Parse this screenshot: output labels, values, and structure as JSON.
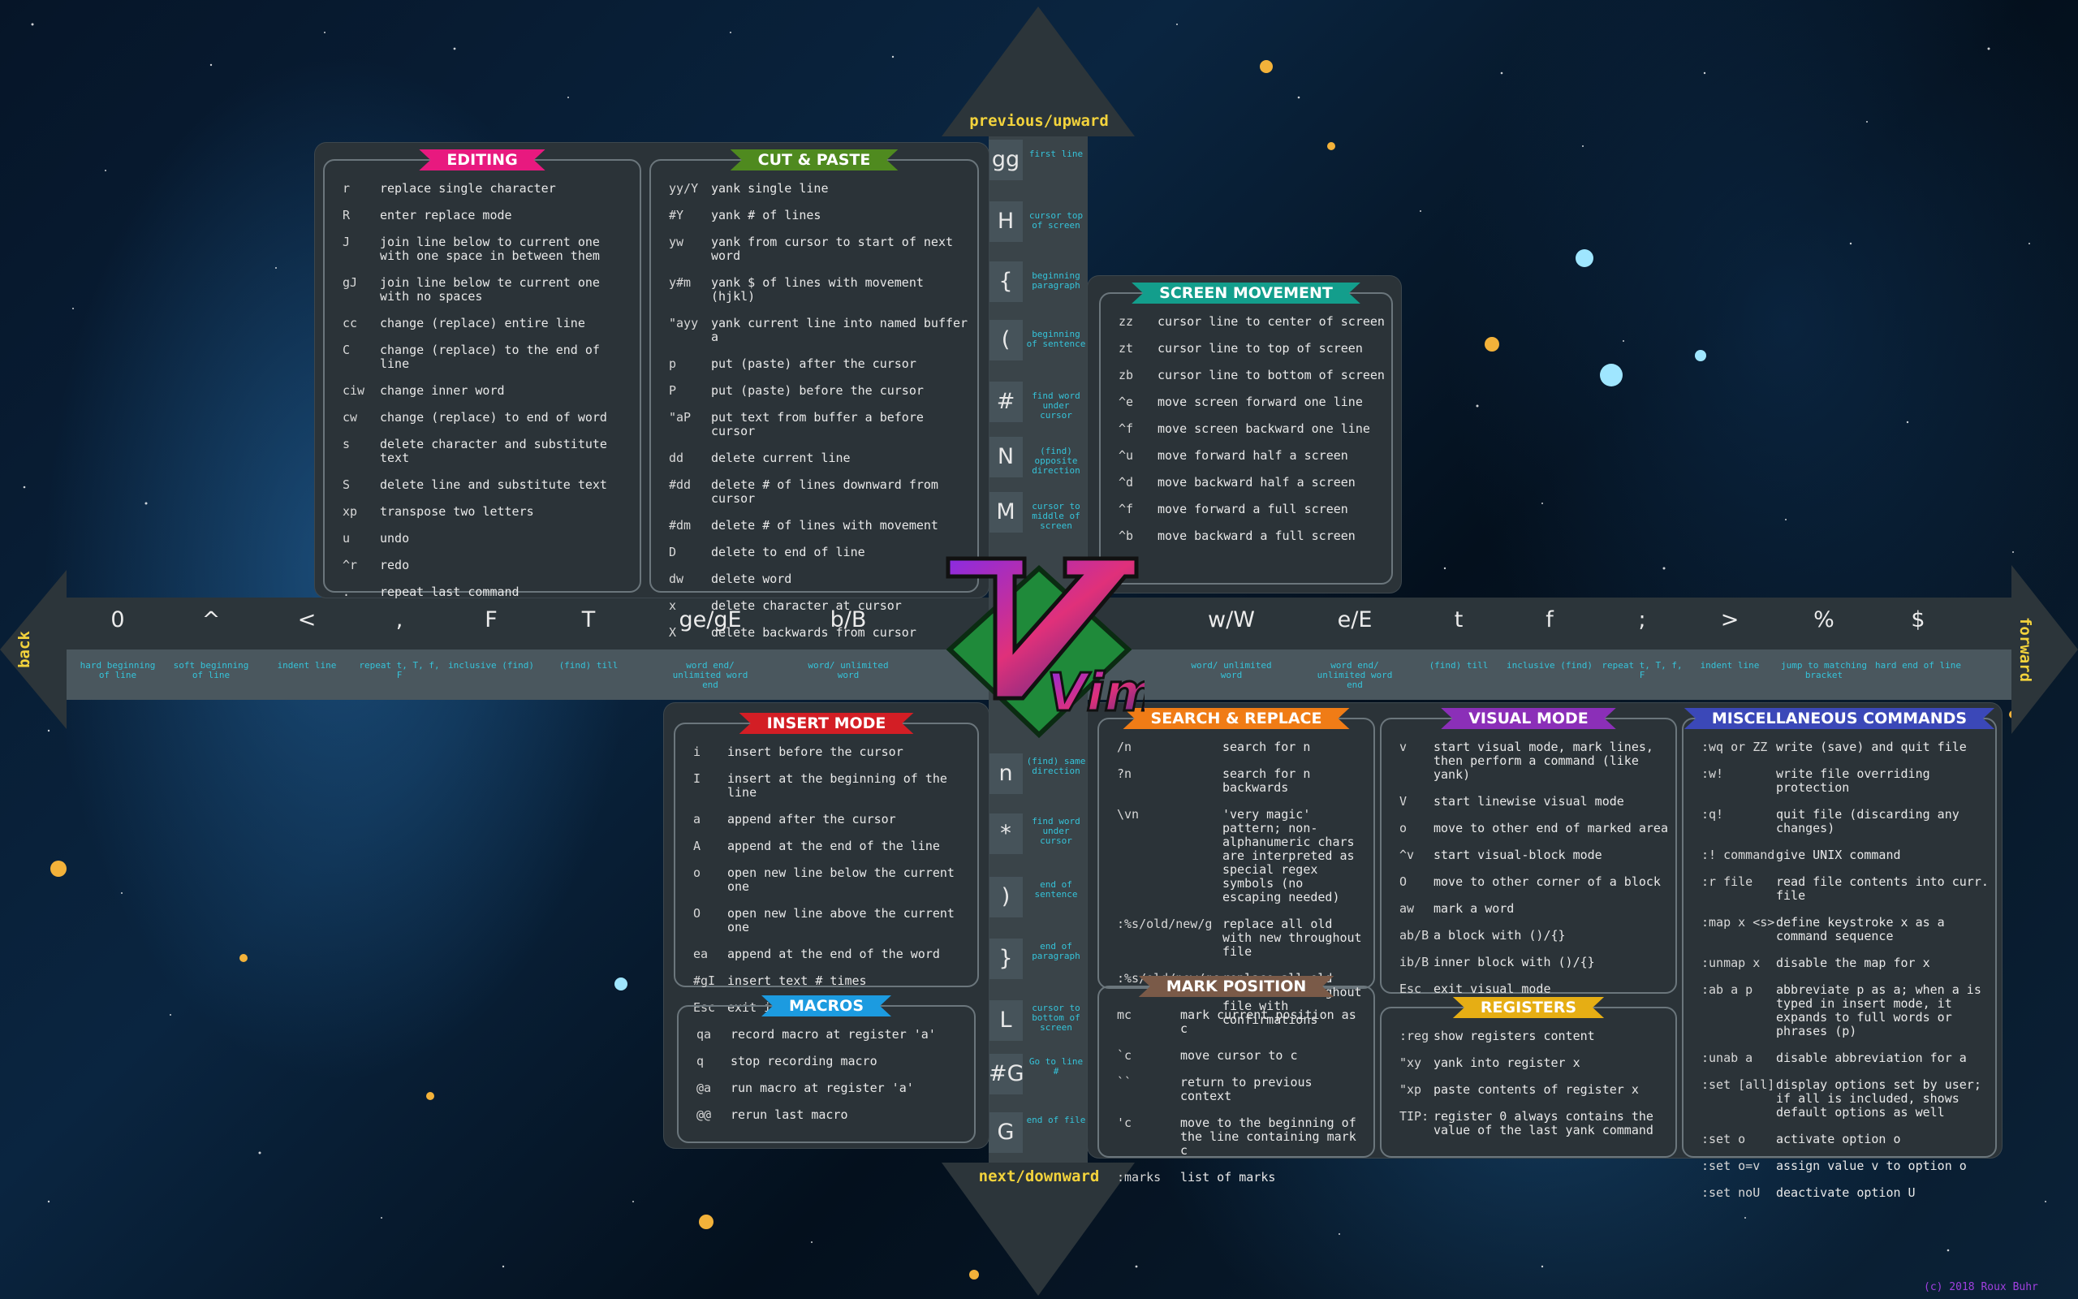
{
  "arrows": {
    "up": "previous/upward",
    "down": "next/downward",
    "left": "back",
    "right": "forward"
  },
  "logo": {
    "text": "Vim"
  },
  "copyright": "(c) 2018 Roux Buhr",
  "vertical_up": [
    {
      "key": "gg",
      "desc": "first line"
    },
    {
      "key": "H",
      "desc": "cursor top of screen"
    },
    {
      "key": "{",
      "desc": "beginning paragraph"
    },
    {
      "key": "(",
      "desc": "beginning of sentence"
    },
    {
      "key": "#",
      "desc": "find word under cursor"
    },
    {
      "key": "N",
      "desc": "(find) opposite direction"
    },
    {
      "key": "M",
      "desc": "cursor to middle of screen"
    }
  ],
  "vertical_down": [
    {
      "key": "n",
      "desc": "(find) same direction"
    },
    {
      "key": "*",
      "desc": "find word under cursor"
    },
    {
      "key": ")",
      "desc": "end of sentence"
    },
    {
      "key": "}",
      "desc": "end of paragraph"
    },
    {
      "key": "L",
      "desc": "cursor to bottom of screen"
    },
    {
      "key": "#G",
      "desc": "Go to line #"
    },
    {
      "key": "G",
      "desc": "end of file"
    }
  ],
  "horizontal_left": [
    {
      "key": "0",
      "desc": "hard beginning of line"
    },
    {
      "key": "^",
      "desc": "soft beginning of line"
    },
    {
      "key": "<",
      "desc": "indent line"
    },
    {
      "key": ",",
      "desc": "repeat t, T, f, F"
    },
    {
      "key": "F",
      "desc": "inclusive (find)"
    },
    {
      "key": "T",
      "desc": "(find) till"
    },
    {
      "key": "ge/gE",
      "desc": "word end/ unlimited word end"
    },
    {
      "key": "b/B",
      "desc": "word/ unlimited word"
    }
  ],
  "horizontal_right": [
    {
      "key": "w/W",
      "desc": "word/ unlimited word"
    },
    {
      "key": "e/E",
      "desc": "word end/ unlimited word end"
    },
    {
      "key": "t",
      "desc": "(find) till"
    },
    {
      "key": "f",
      "desc": "inclusive (find)"
    },
    {
      "key": ";",
      "desc": "repeat t, T, f, F"
    },
    {
      "key": ">",
      "desc": "indent line"
    },
    {
      "key": "%",
      "desc": "jump to matching bracket"
    },
    {
      "key": "$",
      "desc": "hard end of line"
    }
  ],
  "sections": {
    "editing": {
      "title": "EDITING",
      "color": "#e8197f",
      "items": [
        [
          "r",
          "replace single character"
        ],
        [
          "R",
          "enter replace mode"
        ],
        [
          "J",
          "join line below to current one with one space in between them"
        ],
        [
          "gJ",
          "join line below te current one with no spaces"
        ],
        [
          "cc",
          "change (replace) entire line"
        ],
        [
          "C",
          "change (replace) to the end of line"
        ],
        [
          "ciw",
          "change inner word"
        ],
        [
          "cw",
          "change (replace) to end of word"
        ],
        [
          "s",
          "delete character and substitute text"
        ],
        [
          "S",
          "delete line and substitute text"
        ],
        [
          "xp",
          "transpose two letters"
        ],
        [
          "u",
          "undo"
        ],
        [
          "^r",
          "redo"
        ],
        [
          ".",
          "repeat last command"
        ]
      ]
    },
    "cut_paste": {
      "title": "CUT & PASTE",
      "color": "#4f8a1f",
      "items": [
        [
          "yy/Y",
          "yank single line"
        ],
        [
          "#Y",
          "yank # of lines"
        ],
        [
          "yw",
          "yank from cursor to start of next word"
        ],
        [
          "y#m",
          "yank $ of lines with movement (hjkl)"
        ],
        [
          "\"ayy",
          "yank current line into named buffer a"
        ],
        [
          "p",
          "put (paste) after the cursor"
        ],
        [
          "P",
          "put (paste) before the cursor"
        ],
        [
          "\"aP",
          "put text from buffer a before cursor"
        ],
        [
          "dd",
          "delete current line"
        ],
        [
          "#dd",
          "delete # of lines downward from cursor"
        ],
        [
          "#dm",
          "delete # of lines with movement"
        ],
        [
          "D",
          "delete to end of line"
        ],
        [
          "dw",
          "delete word"
        ],
        [
          "x",
          "delete character at cursor"
        ],
        [
          "X",
          "delete backwards from cursor"
        ]
      ]
    },
    "screen_movement": {
      "title": "SCREEN MOVEMENT",
      "color": "#139e8c",
      "items": [
        [
          "zz",
          "cursor line to center of screen"
        ],
        [
          "zt",
          "cursor line to top of screen"
        ],
        [
          "zb",
          "cursor line to bottom of screen"
        ],
        [
          "^e",
          "move screen forward one line"
        ],
        [
          "^f",
          "move screen backward one line"
        ],
        [
          "^u",
          "move forward half a screen"
        ],
        [
          "^d",
          "move backward half a screen"
        ],
        [
          "^f",
          "move forward a full screen"
        ],
        [
          "^b",
          "move backward a full screen"
        ]
      ]
    },
    "insert_mode": {
      "title": "INSERT MODE",
      "color": "#d31e25",
      "items": [
        [
          "i",
          "insert before the cursor"
        ],
        [
          "I",
          "insert at the beginning of the line"
        ],
        [
          "a",
          "append after the cursor"
        ],
        [
          "A",
          "append at the end of the line"
        ],
        [
          "o",
          "open new line below the current one"
        ],
        [
          "O",
          "open new line above the current one"
        ],
        [
          "ea",
          "append at the end of the word"
        ],
        [
          "#gI",
          "insert text # times"
        ],
        [
          "Esc",
          "exit insert mode"
        ]
      ]
    },
    "macros": {
      "title": "MACROS",
      "color": "#1c9be0",
      "items": [
        [
          "qa",
          "record macro at register 'a'"
        ],
        [
          "q",
          "stop recording macro"
        ],
        [
          "@a",
          "run macro at register 'a'"
        ],
        [
          "@@",
          "rerun last macro"
        ]
      ]
    },
    "search_replace": {
      "title": "SEARCH & REPLACE",
      "color": "#f07c16",
      "items": [
        [
          "/n",
          "search for n"
        ],
        [
          "?n",
          "search for n backwards"
        ],
        [
          "\\vn",
          "'very magic' pattern; non-alphanumeric chars are interpreted as special regex symbols (no escaping needed)"
        ],
        [
          ":%s/old/new/g",
          "replace all old with new throughout file"
        ],
        [
          ":%s/old/new/gc",
          "replace all old with new throughout file with confirmations"
        ]
      ]
    },
    "mark_position": {
      "title": "MARK POSITION",
      "color": "#7a5a48",
      "items": [
        [
          "mc",
          "mark current position as c"
        ],
        [
          "`c",
          "move cursor to c"
        ],
        [
          "``",
          "return to previous context"
        ],
        [
          "'c",
          "move to the beginning of the line containing mark c"
        ],
        [
          ":marks",
          "list of marks"
        ]
      ]
    },
    "visual_mode": {
      "title": "VISUAL MODE",
      "color": "#8b2fb8",
      "items": [
        [
          "v",
          "start visual mode, mark lines, then perform a command (like yank)"
        ],
        [
          "V",
          "start linewise visual mode"
        ],
        [
          "o",
          "move to other end of marked area"
        ],
        [
          "^v",
          "start visual-block mode"
        ],
        [
          "O",
          "move to other corner of a block"
        ],
        [
          "aw",
          "mark a word"
        ],
        [
          "ab/B",
          "a block with ()/{}"
        ],
        [
          "ib/B",
          "inner block with ()/{}"
        ],
        [
          "Esc",
          "exit visual mode"
        ]
      ]
    },
    "registers": {
      "title": "REGISTERS",
      "color": "#e6ae14",
      "items": [
        [
          ":reg",
          "show registers content"
        ],
        [
          "\"xy",
          "yank into register x"
        ],
        [
          "\"xp",
          "paste contents of register x"
        ],
        [
          "TIP:",
          "register 0 always contains the value of the last yank command"
        ]
      ]
    },
    "misc": {
      "title": "MISCELLANEOUS COMMANDS",
      "color": "#3b48b8",
      "items": [
        [
          ":wq or ZZ",
          "write (save) and quit file"
        ],
        [
          ":w!",
          "write file overriding protection"
        ],
        [
          ":q!",
          "quit file (discarding any changes)"
        ],
        [
          ":! command",
          "give UNIX command"
        ],
        [
          ":r file",
          "read file contents into curr. file"
        ],
        [
          ":map x <s>",
          "define keystroke x as a command sequence"
        ],
        [
          ":unmap x",
          "disable the map for x"
        ],
        [
          ":ab a p",
          "abbreviate p as a; when a is typed in insert mode, it expands to full words or phrases (p)"
        ],
        [
          ":unab a",
          "disable abbreviation for a"
        ],
        [
          ":set [all]",
          "display options set by user; if all is included, shows default options as well"
        ],
        [
          ":set o",
          "activate option o"
        ],
        [
          ":set o=v",
          "assign value v to option o"
        ],
        [
          ":set noU",
          "deactivate option U"
        ]
      ]
    }
  }
}
